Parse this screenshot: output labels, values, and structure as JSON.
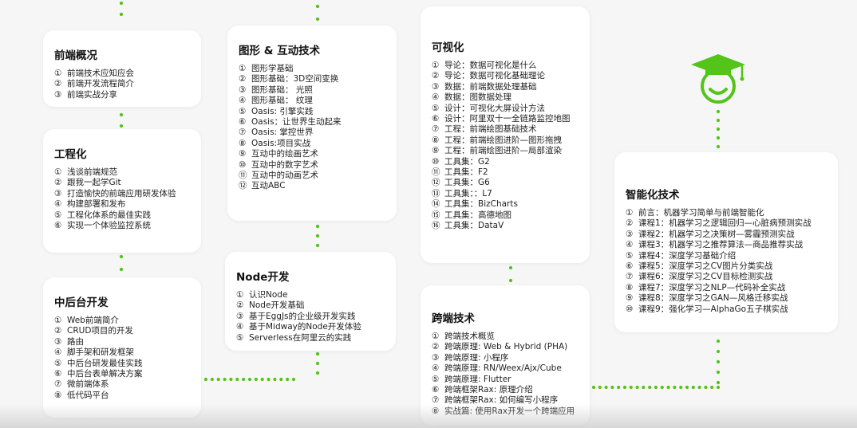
{
  "colors": {
    "accent": "#52c41a",
    "card": "#ffffff",
    "background": "#f6f6f6"
  },
  "icons": {
    "mascot": "graduation-cap-smiley-icon"
  },
  "cards": [
    {
      "title": "前端概况",
      "items": [
        {
          "num": "①",
          "text": "前端技术应知应会"
        },
        {
          "num": "②",
          "text": "前端开发流程简介"
        },
        {
          "num": "③",
          "text": "前端实战分享"
        }
      ]
    },
    {
      "title": "工程化",
      "items": [
        {
          "num": "①",
          "text": "浅谈前端规范"
        },
        {
          "num": "②",
          "text": "跟我一起学Git"
        },
        {
          "num": "③",
          "text": "打造愉快的前端应用研发体验"
        },
        {
          "num": "④",
          "text": "构建部署和发布"
        },
        {
          "num": "⑤",
          "text": "工程化体系的最佳实践"
        },
        {
          "num": "⑥",
          "text": "实现一个体验监控系统"
        }
      ]
    },
    {
      "title": "中后台开发",
      "items": [
        {
          "num": "①",
          "text": "Web前端简介"
        },
        {
          "num": "②",
          "text": "CRUD项目的开发"
        },
        {
          "num": "③",
          "text": "路由"
        },
        {
          "num": "④",
          "text": "脚手架和研发框架"
        },
        {
          "num": "⑤",
          "text": "中后台研发最佳实践"
        },
        {
          "num": "⑥",
          "text": "中后台表单解决方案"
        },
        {
          "num": "⑦",
          "text": "微前端体系"
        },
        {
          "num": "⑧",
          "text": "低代码平台"
        }
      ]
    },
    {
      "title": "图形 & 互动技术",
      "items": [
        {
          "num": "①",
          "text": "图形学基础"
        },
        {
          "num": "②",
          "text": "图形基础：3D空间变换"
        },
        {
          "num": "③",
          "text": "图形基础： 光照"
        },
        {
          "num": "④",
          "text": "图形基础： 纹理"
        },
        {
          "num": "⑤",
          "text": "Oasis: 引擎实践"
        },
        {
          "num": "⑥",
          "text": "Oasis：让世界生动起来"
        },
        {
          "num": "⑦",
          "text": "Oasis: 掌控世界"
        },
        {
          "num": "⑧",
          "text": "Oasis:项目实战"
        },
        {
          "num": "⑨",
          "text": "互动中的绘画艺术"
        },
        {
          "num": "⑩",
          "text": "互动中的数字艺术"
        },
        {
          "num": "⑪",
          "text": "互动中的动画艺术"
        },
        {
          "num": "⑫",
          "text": "互动ABC"
        }
      ]
    },
    {
      "title": "Node开发",
      "items": [
        {
          "num": "①",
          "text": "认识Node"
        },
        {
          "num": "②",
          "text": "Node开发基础"
        },
        {
          "num": "③",
          "text": "基于EggJs的企业级开发实践"
        },
        {
          "num": "④",
          "text": "基于Midway的Node开发体验"
        },
        {
          "num": "⑤",
          "text": "Serverless在阿里云的实践"
        }
      ]
    },
    {
      "title": "可视化",
      "items": [
        {
          "num": "①",
          "text": "导论：数据可视化是什么"
        },
        {
          "num": "②",
          "text": "导论：数据可视化基础理论"
        },
        {
          "num": "③",
          "text": "数据：前端数据处理基础"
        },
        {
          "num": "④",
          "text": "数据：图数据处理"
        },
        {
          "num": "⑤",
          "text": "设计：可视化大屏设计方法"
        },
        {
          "num": "⑥",
          "text": "设计：阿里双十一全链路监控地图"
        },
        {
          "num": "⑦",
          "text": "工程：前端绘图基础技术"
        },
        {
          "num": "⑧",
          "text": "工程：前端绘图进阶—图形拖拽"
        },
        {
          "num": "⑨",
          "text": "工程：前端绘图进阶—局部渲染"
        },
        {
          "num": "⑩",
          "text": "工具集：G2"
        },
        {
          "num": "⑪",
          "text": "工具集：F2"
        },
        {
          "num": "⑫",
          "text": "工具集：G6"
        },
        {
          "num": "⑬",
          "text": "工具集：：L7"
        },
        {
          "num": "⑭",
          "text": "工具集：BizCharts"
        },
        {
          "num": "⑮",
          "text": "工具集：高德地图"
        },
        {
          "num": "⑯",
          "text": "工具集：DataV"
        }
      ]
    },
    {
      "title": "跨端技术",
      "items": [
        {
          "num": "①",
          "text": "跨端技术概览"
        },
        {
          "num": "②",
          "text": "跨端原理: Web & Hybrid (PHA)"
        },
        {
          "num": "③",
          "text": "跨端原理: 小程序"
        },
        {
          "num": "④",
          "text": "跨端原理: RN/Weex/Ajx/Cube"
        },
        {
          "num": "⑤",
          "text": "跨端原理: Flutter"
        },
        {
          "num": "⑥",
          "text": "跨端框架Rax: 原理介绍"
        },
        {
          "num": "⑦",
          "text": "跨端框架Rax: 如何编写小程序"
        },
        {
          "num": "⑧",
          "text": "实战篇: 使用Rax开发一个跨端应用"
        }
      ]
    },
    {
      "title": "智能化技术",
      "items": [
        {
          "num": "①",
          "text": "前言：机器学习简单与前端智能化"
        },
        {
          "num": "②",
          "text": "课程1：机器学习之逻辑回归—心脏病预测实战"
        },
        {
          "num": "③",
          "text": "课程2：机器学习之决策树—雾霾预测实战"
        },
        {
          "num": "④",
          "text": "课程3：机器学习之推荐算法—商品推荐实战"
        },
        {
          "num": "⑤",
          "text": "课程4：深度学习基础介绍"
        },
        {
          "num": "⑥",
          "text": "课程5：深度学习之CV图片分类实战"
        },
        {
          "num": "⑦",
          "text": "课程6：深度学习之CV目标检测实战"
        },
        {
          "num": "⑧",
          "text": "课程7：深度学习之NLP—代码补全实战"
        },
        {
          "num": "⑨",
          "text": "课程8：深度学习之GAN—风格迁移实战"
        },
        {
          "num": "⑩",
          "text": "课程9：强化学习—AlphaGo五子棋实战"
        }
      ]
    }
  ]
}
